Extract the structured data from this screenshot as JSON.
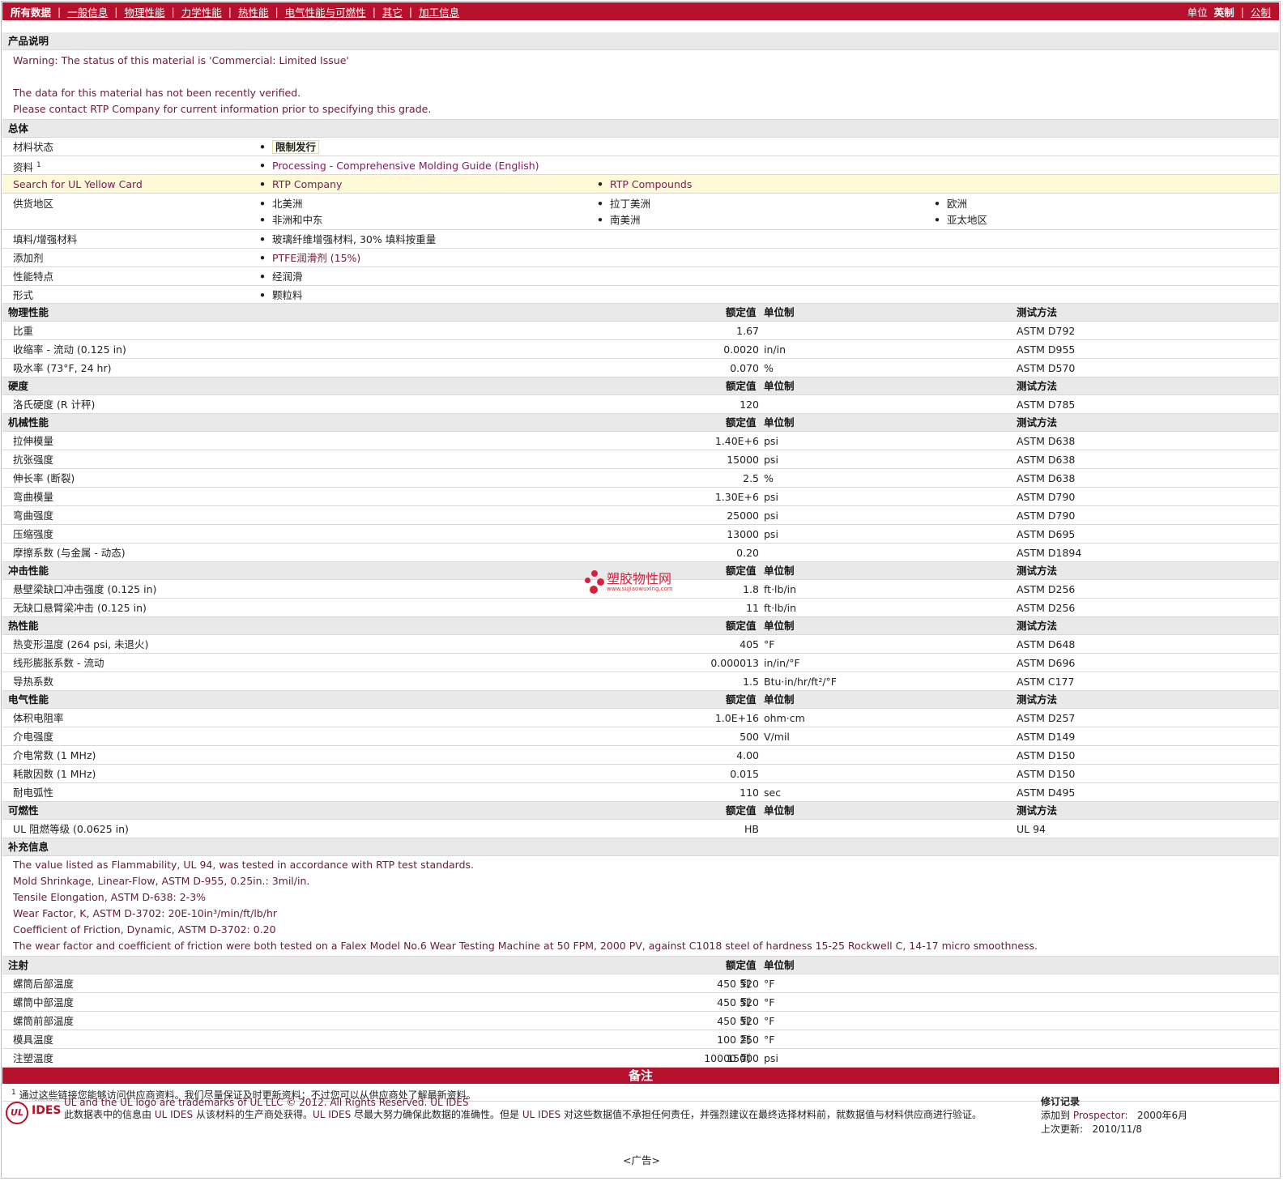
{
  "nav": {
    "all_data": "所有数据",
    "tabs": [
      "一般信息",
      "物理性能",
      "力学性能",
      "热性能",
      "电气性能与可燃性",
      "其它",
      "加工信息"
    ],
    "units_label": "单位",
    "units_selected": "英制",
    "units_other": "公制"
  },
  "product_desc": {
    "title": "产品说明",
    "lines": [
      "Warning: The status of this material is 'Commercial: Limited Issue'",
      "",
      "The data for this material has not been recently verified.",
      "Please contact RTP Company for current information prior to specifying this grade."
    ]
  },
  "general": {
    "title": "总体",
    "status_label": "材料状态",
    "status_value": "限制发行",
    "docs_label": "资料",
    "docs_sup": "1",
    "docs_link": "Processing - Comprehensive Molding Guide (English)",
    "ul_label": "Search for UL Yellow Card",
    "ul_link1": "RTP Company",
    "ul_link2": "RTP Compounds",
    "supply_label": "供货地区",
    "supply": [
      "北美洲",
      "拉丁美洲",
      "欧洲",
      "非洲和中东",
      "南美洲",
      "亚太地区"
    ],
    "filler_label": "填料/增强材料",
    "filler_value": "玻璃纤维增强材料, 30% 填料按重量",
    "additive_label": "添加剂",
    "additive_value": "PTFE润滑剂 (15%)",
    "feature_label": "性能特点",
    "feature_value": "经润滑",
    "form_label": "形式",
    "form_value": "颗粒料"
  },
  "headers": {
    "value": "额定值",
    "unit": "单位制",
    "test": "测试方法"
  },
  "sections": [
    {
      "title": "物理性能",
      "rows": [
        {
          "label": "比重",
          "value": "1.67",
          "unit": "",
          "test": "ASTM D792"
        },
        {
          "label": "收缩率  - 流动  (0.125 in)",
          "value": "0.0020",
          "unit": "in/in",
          "test": "ASTM D955"
        },
        {
          "label": "吸水率  (73°F, 24 hr)",
          "value": "0.070",
          "unit": "%",
          "test": "ASTM D570"
        }
      ]
    },
    {
      "title": "硬度",
      "rows": [
        {
          "label": "洛氏硬度  (R 计秤)",
          "value": "120",
          "unit": "",
          "test": "ASTM D785"
        }
      ]
    },
    {
      "title": "机械性能",
      "rows": [
        {
          "label": "拉伸模量",
          "value": "1.40E+6",
          "unit": "psi",
          "test": "ASTM D638"
        },
        {
          "label": "抗张强度",
          "value": "15000",
          "unit": "psi",
          "test": "ASTM D638"
        },
        {
          "label": "伸长率  (断裂)",
          "value": "2.5",
          "unit": "%",
          "test": "ASTM D638"
        },
        {
          "label": "弯曲模量",
          "value": "1.30E+6",
          "unit": "psi",
          "test": "ASTM D790"
        },
        {
          "label": "弯曲强度",
          "value": "25000",
          "unit": "psi",
          "test": "ASTM D790"
        },
        {
          "label": "压缩强度",
          "value": "13000",
          "unit": "psi",
          "test": "ASTM D695"
        },
        {
          "label": "摩擦系数  (与金属  - 动态)",
          "value": "0.20",
          "unit": "",
          "test": "ASTM D1894"
        }
      ]
    },
    {
      "title": "冲击性能",
      "rows": [
        {
          "label": "悬壁梁缺口冲击强度  (0.125 in)",
          "value": "1.8",
          "unit": "ft·lb/in",
          "test": "ASTM D256"
        },
        {
          "label": "无缺口悬臂梁冲击  (0.125 in)",
          "value": "11",
          "unit": "ft·lb/in",
          "test": "ASTM D256"
        }
      ]
    },
    {
      "title": "热性能",
      "rows": [
        {
          "label": "热变形温度  (264 psi, 未退火)",
          "value": "405",
          "unit": "°F",
          "test": "ASTM D648"
        },
        {
          "label": "线形膨胀系数  - 流动",
          "value": "0.000013",
          "unit": "in/in/°F",
          "test": "ASTM D696"
        },
        {
          "label": "导热系数",
          "value": "1.5",
          "unit": "Btu·in/hr/ft²/°F",
          "test": "ASTM C177"
        }
      ]
    },
    {
      "title": "电气性能",
      "rows": [
        {
          "label": "体积电阻率",
          "value": "1.0E+16",
          "unit": "ohm·cm",
          "test": "ASTM D257"
        },
        {
          "label": "介电强度",
          "value": "500",
          "unit": "V/mil",
          "test": "ASTM D149"
        },
        {
          "label": "介电常数  (1 MHz)",
          "value": "4.00",
          "unit": "",
          "test": "ASTM D150"
        },
        {
          "label": "耗散因数  (1 MHz)",
          "value": "0.015",
          "unit": "",
          "test": "ASTM D150"
        },
        {
          "label": "耐电弧性",
          "value": "110",
          "unit": "sec",
          "test": "ASTM D495"
        }
      ]
    },
    {
      "title": "可燃性",
      "rows": [
        {
          "label": "UL 阻燃等级  (0.0625 in)",
          "value": "HB",
          "unit": "",
          "test": "UL 94"
        }
      ]
    }
  ],
  "supplemental": {
    "title": "补充信息",
    "lines": [
      "The value listed as Flammability, UL 94, was tested in accordance with RTP test standards.",
      "Mold Shrinkage, Linear-Flow, ASTM D-955, 0.25in.: 3mil/in.",
      "Tensile Elongation, ASTM D-638: 2-3%",
      "Wear Factor, K, ASTM D-3702: 20E-10in³/min/ft/lb/hr",
      "Coefficient of Friction, Dynamic, ASTM D-3702: 0.20",
      "The wear factor and coefficient of friction were both tested on a Falex Model No.6 Wear Testing Machine at 50 FPM, 2000 PV, against C1018 steel of hardness 15-25 Rockwell C, 14-17 micro smoothness."
    ]
  },
  "injection": {
    "title": "注射",
    "to": "到",
    "rows": [
      {
        "label": "螺筒后部温度",
        "from": "450",
        "to": "520",
        "unit": "°F"
      },
      {
        "label": "螺筒中部温度",
        "from": "450",
        "to": "520",
        "unit": "°F"
      },
      {
        "label": "螺筒前部温度",
        "from": "450",
        "to": "520",
        "unit": "°F"
      },
      {
        "label": "模具温度",
        "from": "100",
        "to": "250",
        "unit": "°F"
      },
      {
        "label": "注塑温度",
        "from": "10000",
        "to": "15000",
        "unit": "psi"
      }
    ]
  },
  "notes": {
    "title": "备注",
    "sup": "1",
    "text": "通过这些链接您能够访问供应商资料。我们尽量保证及时更新资料；不过您可以从供应商处了解最新资料。"
  },
  "footer": {
    "logo_small": "Powered by",
    "logo_ul": "UL",
    "logo_ides": "IDES",
    "trademark": "UL and the UL logo are trademarks of UL LLC © 2012. All Rights Reserved.",
    "ul_ides": "UL IDES",
    "disclaimer_1": "此数据表中的信息由",
    "disclaimer_2": "从该材料的生产商处获得。",
    "disclaimer_3": "尽最大努力确保此数据的准确性。但是",
    "disclaimer_4": "对这些数据值不承担任何责任，并强烈建议在最终选择材料前，就数据值与材料供应商进行验证。",
    "revision_title": "修订记录",
    "added_label": "添加到",
    "added_source": "Prospector:",
    "added_date": "2000年6月",
    "updated_label": "上次更新:",
    "updated_date": "2010/11/8"
  },
  "watermark": {
    "text": "塑胶物性网",
    "url": "www.sujiaowuxing.com"
  },
  "ads": "<广告>"
}
